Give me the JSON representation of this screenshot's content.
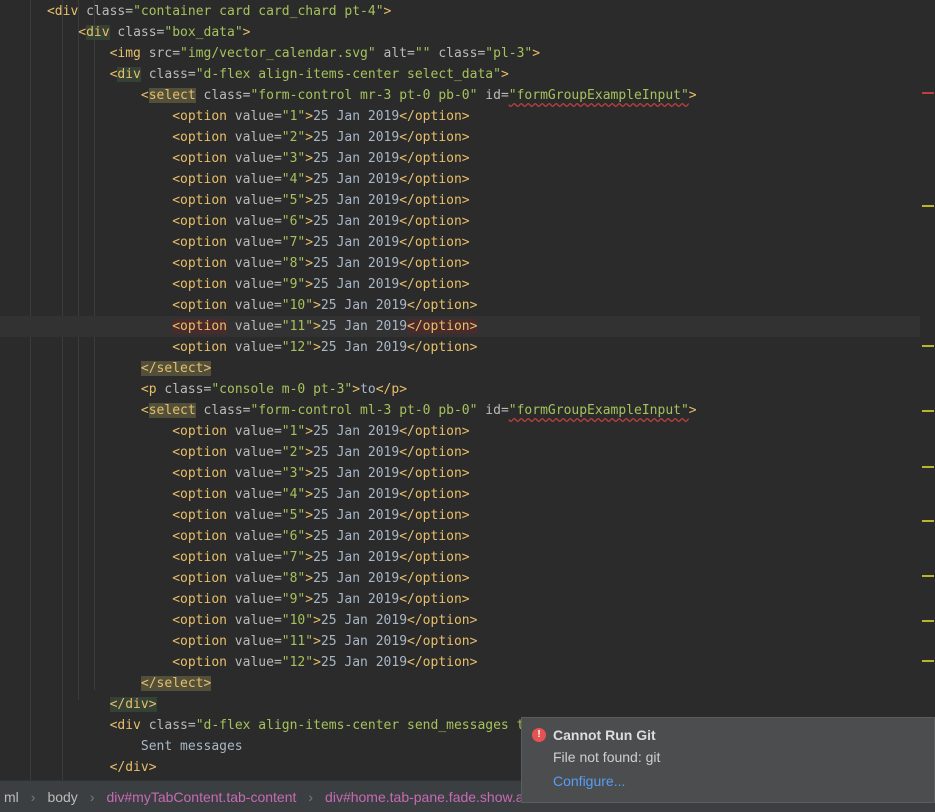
{
  "code_lines": [
    {
      "indent": "  ",
      "parts": [
        [
          "<",
          "tag"
        ],
        [
          "div",
          "tag"
        ],
        [
          " class=",
          "attr"
        ],
        [
          "\"container card card_chard pt-4\"",
          "val"
        ],
        [
          ">",
          "tag"
        ]
      ]
    },
    {
      "indent": "    ",
      "parts": [
        [
          "<",
          "tag"
        ],
        [
          "div",
          "tag",
          "hl-green"
        ],
        [
          " class=",
          "attr"
        ],
        [
          "\"box_data\"",
          "val"
        ],
        [
          ">",
          "tag"
        ]
      ]
    },
    {
      "indent": "      ",
      "parts": [
        [
          "<",
          "tag"
        ],
        [
          "img",
          "tag"
        ],
        [
          " src=",
          "attr"
        ],
        [
          "\"img/vector_calendar.svg\"",
          "val"
        ],
        [
          " alt=",
          "attr"
        ],
        [
          "\"\"",
          "val"
        ],
        [
          " class=",
          "attr"
        ],
        [
          "\"pl-3\"",
          "val"
        ],
        [
          ">",
          "tag"
        ]
      ]
    },
    {
      "indent": "      ",
      "parts": [
        [
          "<",
          "tag"
        ],
        [
          "div",
          "tag",
          "hl-green"
        ],
        [
          " class=",
          "attr"
        ],
        [
          "\"d-flex align-items-center select_data\"",
          "val"
        ],
        [
          ">",
          "tag"
        ]
      ]
    },
    {
      "indent": "        ",
      "parts": [
        [
          "<",
          "tag"
        ],
        [
          "select",
          "tag",
          "hl-yellow"
        ],
        [
          " class=",
          "attr"
        ],
        [
          "\"form-control mr-3 pt-0 pb-0\"",
          "val"
        ],
        [
          " id=",
          "attr"
        ],
        [
          "\"formGroupExampleInput\"",
          "val",
          "underline"
        ],
        [
          ">",
          "tag"
        ]
      ]
    },
    {
      "indent": "          ",
      "parts": [
        [
          "<option",
          "tag"
        ],
        [
          " value=",
          "attr"
        ],
        [
          "\"1\"",
          "val"
        ],
        [
          ">",
          "tag"
        ],
        [
          "25 Jan 2019",
          "plain"
        ],
        [
          "</option>",
          "tag"
        ]
      ]
    },
    {
      "indent": "          ",
      "parts": [
        [
          "<option",
          "tag"
        ],
        [
          " value=",
          "attr"
        ],
        [
          "\"2\"",
          "val"
        ],
        [
          ">",
          "tag"
        ],
        [
          "25 Jan 2019",
          "plain"
        ],
        [
          "</option>",
          "tag"
        ]
      ]
    },
    {
      "indent": "          ",
      "parts": [
        [
          "<option",
          "tag"
        ],
        [
          " value=",
          "attr"
        ],
        [
          "\"3\"",
          "val"
        ],
        [
          ">",
          "tag"
        ],
        [
          "25 Jan 2019",
          "plain"
        ],
        [
          "</option>",
          "tag"
        ]
      ]
    },
    {
      "indent": "          ",
      "parts": [
        [
          "<option",
          "tag"
        ],
        [
          " value=",
          "attr"
        ],
        [
          "\"4\"",
          "val"
        ],
        [
          ">",
          "tag"
        ],
        [
          "25 Jan 2019",
          "plain"
        ],
        [
          "</option>",
          "tag"
        ]
      ]
    },
    {
      "indent": "          ",
      "parts": [
        [
          "<option",
          "tag"
        ],
        [
          " value=",
          "attr"
        ],
        [
          "\"5\"",
          "val"
        ],
        [
          ">",
          "tag"
        ],
        [
          "25 Jan 2019",
          "plain"
        ],
        [
          "</option>",
          "tag"
        ]
      ]
    },
    {
      "indent": "          ",
      "parts": [
        [
          "<option",
          "tag"
        ],
        [
          " value=",
          "attr"
        ],
        [
          "\"6\"",
          "val"
        ],
        [
          ">",
          "tag"
        ],
        [
          "25 Jan 2019",
          "plain"
        ],
        [
          "</option>",
          "tag"
        ]
      ]
    },
    {
      "indent": "          ",
      "parts": [
        [
          "<option",
          "tag"
        ],
        [
          " value=",
          "attr"
        ],
        [
          "\"7\"",
          "val"
        ],
        [
          ">",
          "tag"
        ],
        [
          "25 Jan 2019",
          "plain"
        ],
        [
          "</option>",
          "tag"
        ]
      ]
    },
    {
      "indent": "          ",
      "parts": [
        [
          "<option",
          "tag"
        ],
        [
          " value=",
          "attr"
        ],
        [
          "\"8\"",
          "val"
        ],
        [
          ">",
          "tag"
        ],
        [
          "25 Jan 2019",
          "plain"
        ],
        [
          "</option>",
          "tag"
        ]
      ]
    },
    {
      "indent": "          ",
      "parts": [
        [
          "<option",
          "tag"
        ],
        [
          " value=",
          "attr"
        ],
        [
          "\"9\"",
          "val"
        ],
        [
          ">",
          "tag"
        ],
        [
          "25 Jan 2019",
          "plain"
        ],
        [
          "</option>",
          "tag"
        ]
      ]
    },
    {
      "indent": "          ",
      "parts": [
        [
          "<option",
          "tag"
        ],
        [
          " value=",
          "attr"
        ],
        [
          "\"10\"",
          "val"
        ],
        [
          ">",
          "tag"
        ],
        [
          "25 Jan 2019",
          "plain"
        ],
        [
          "</option>",
          "tag"
        ]
      ]
    },
    {
      "indent": "          ",
      "current": true,
      "parts": [
        [
          "<option",
          "tag",
          "hl-red"
        ],
        [
          " value=",
          "attr"
        ],
        [
          "\"11\"",
          "val"
        ],
        [
          ">",
          "tag"
        ],
        [
          "25 Jan 2019",
          "plain"
        ],
        [
          "</option>",
          "tag",
          "hl-red"
        ]
      ]
    },
    {
      "indent": "          ",
      "parts": [
        [
          "<option",
          "tag"
        ],
        [
          " value=",
          "attr"
        ],
        [
          "\"12\"",
          "val"
        ],
        [
          ">",
          "tag"
        ],
        [
          "25 Jan 2019",
          "plain"
        ],
        [
          "</option>",
          "tag"
        ]
      ]
    },
    {
      "indent": "        ",
      "parts": [
        [
          "</select>",
          "tag",
          "hl-yellow"
        ]
      ]
    },
    {
      "indent": "        ",
      "parts": [
        [
          "<p",
          "tag"
        ],
        [
          " class=",
          "attr"
        ],
        [
          "\"console m-0 pt-3\"",
          "val"
        ],
        [
          ">",
          "tag"
        ],
        [
          "to",
          "plain"
        ],
        [
          "</p>",
          "tag"
        ]
      ]
    },
    {
      "indent": "        ",
      "parts": [
        [
          "<",
          "tag"
        ],
        [
          "select",
          "tag",
          "hl-yellow"
        ],
        [
          " class=",
          "attr"
        ],
        [
          "\"form-control ml-3 pt-0 pb-0\"",
          "val"
        ],
        [
          " id=",
          "attr"
        ],
        [
          "\"formGroupExampleInput\"",
          "val",
          "underline"
        ],
        [
          ">",
          "tag"
        ]
      ]
    },
    {
      "indent": "          ",
      "parts": [
        [
          "<option",
          "tag"
        ],
        [
          " value=",
          "attr"
        ],
        [
          "\"1\"",
          "val"
        ],
        [
          ">",
          "tag"
        ],
        [
          "25 Jan 2019",
          "plain"
        ],
        [
          "</option>",
          "tag"
        ]
      ]
    },
    {
      "indent": "          ",
      "parts": [
        [
          "<option",
          "tag"
        ],
        [
          " value=",
          "attr"
        ],
        [
          "\"2\"",
          "val"
        ],
        [
          ">",
          "tag"
        ],
        [
          "25 Jan 2019",
          "plain"
        ],
        [
          "</option>",
          "tag"
        ]
      ]
    },
    {
      "indent": "          ",
      "parts": [
        [
          "<option",
          "tag"
        ],
        [
          " value=",
          "attr"
        ],
        [
          "\"3\"",
          "val"
        ],
        [
          ">",
          "tag"
        ],
        [
          "25 Jan 2019",
          "plain"
        ],
        [
          "</option>",
          "tag"
        ]
      ]
    },
    {
      "indent": "          ",
      "parts": [
        [
          "<option",
          "tag"
        ],
        [
          " value=",
          "attr"
        ],
        [
          "\"4\"",
          "val"
        ],
        [
          ">",
          "tag"
        ],
        [
          "25 Jan 2019",
          "plain"
        ],
        [
          "</option>",
          "tag"
        ]
      ]
    },
    {
      "indent": "          ",
      "parts": [
        [
          "<option",
          "tag"
        ],
        [
          " value=",
          "attr"
        ],
        [
          "\"5\"",
          "val"
        ],
        [
          ">",
          "tag"
        ],
        [
          "25 Jan 2019",
          "plain"
        ],
        [
          "</option>",
          "tag"
        ]
      ]
    },
    {
      "indent": "          ",
      "parts": [
        [
          "<option",
          "tag"
        ],
        [
          " value=",
          "attr"
        ],
        [
          "\"6\"",
          "val"
        ],
        [
          ">",
          "tag"
        ],
        [
          "25 Jan 2019",
          "plain"
        ],
        [
          "</option>",
          "tag"
        ]
      ]
    },
    {
      "indent": "          ",
      "parts": [
        [
          "<option",
          "tag"
        ],
        [
          " value=",
          "attr"
        ],
        [
          "\"7\"",
          "val"
        ],
        [
          ">",
          "tag"
        ],
        [
          "25 Jan 2019",
          "plain"
        ],
        [
          "</option>",
          "tag"
        ]
      ]
    },
    {
      "indent": "          ",
      "parts": [
        [
          "<option",
          "tag"
        ],
        [
          " value=",
          "attr"
        ],
        [
          "\"8\"",
          "val"
        ],
        [
          ">",
          "tag"
        ],
        [
          "25 Jan 2019",
          "plain"
        ],
        [
          "</option>",
          "tag"
        ]
      ]
    },
    {
      "indent": "          ",
      "parts": [
        [
          "<option",
          "tag"
        ],
        [
          " value=",
          "attr"
        ],
        [
          "\"9\"",
          "val"
        ],
        [
          ">",
          "tag"
        ],
        [
          "25 Jan 2019",
          "plain"
        ],
        [
          "</option>",
          "tag"
        ]
      ]
    },
    {
      "indent": "          ",
      "parts": [
        [
          "<option",
          "tag"
        ],
        [
          " value=",
          "attr"
        ],
        [
          "\"10\"",
          "val"
        ],
        [
          ">",
          "tag"
        ],
        [
          "25 Jan 2019",
          "plain"
        ],
        [
          "</option>",
          "tag"
        ]
      ]
    },
    {
      "indent": "          ",
      "parts": [
        [
          "<option",
          "tag"
        ],
        [
          " value=",
          "attr"
        ],
        [
          "\"11\"",
          "val"
        ],
        [
          ">",
          "tag"
        ],
        [
          "25 Jan 2019",
          "plain"
        ],
        [
          "</option>",
          "tag"
        ]
      ]
    },
    {
      "indent": "          ",
      "parts": [
        [
          "<option",
          "tag"
        ],
        [
          " value=",
          "attr"
        ],
        [
          "\"12\"",
          "val"
        ],
        [
          ">",
          "tag"
        ],
        [
          "25 Jan 2019",
          "plain"
        ],
        [
          "</option>",
          "tag"
        ]
      ]
    },
    {
      "indent": "        ",
      "parts": [
        [
          "</select>",
          "tag",
          "hl-yellow"
        ]
      ]
    },
    {
      "indent": "      ",
      "parts": [
        [
          "</div>",
          "tag",
          "hl-green"
        ]
      ]
    },
    {
      "indent": "      ",
      "parts": [
        [
          "<",
          "tag"
        ],
        [
          "div",
          "tag"
        ],
        [
          " class=",
          "attr"
        ],
        [
          "\"d-flex align-items-center send_messages text",
          "val"
        ]
      ]
    },
    {
      "indent": "        ",
      "parts": [
        [
          "Sent messages",
          "plain"
        ]
      ]
    },
    {
      "indent": "      ",
      "parts": [
        [
          "</div>",
          "tag"
        ]
      ]
    }
  ],
  "breadcrumbs": [
    "ml",
    "body",
    "div#myTabContent.tab-content",
    "div#home.tab-pane.fade.show.active"
  ],
  "notification": {
    "title": "Cannot Run Git",
    "message": "File not found: git",
    "link": "Configure..."
  },
  "colors": {
    "background": "#2b2b2b",
    "tag": "#e8bf6a",
    "attribute": "#bababa",
    "value": "#a5c25c",
    "error": "#e55252",
    "link": "#589df6"
  }
}
